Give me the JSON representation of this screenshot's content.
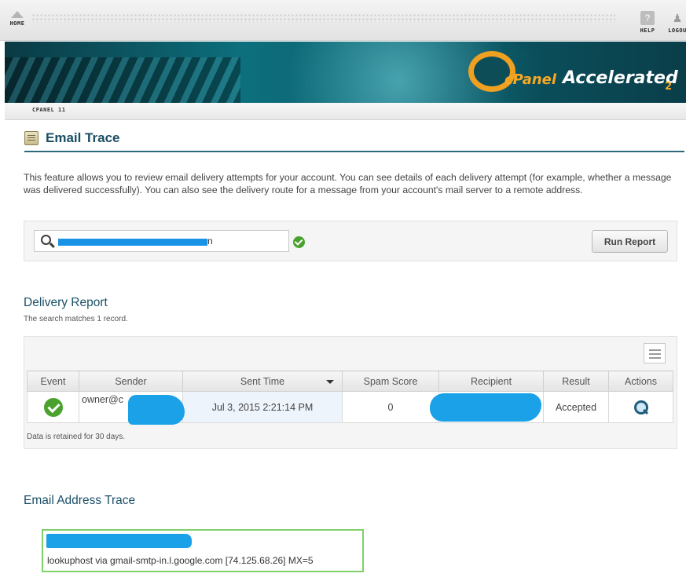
{
  "nav": {
    "home_label": "HOME",
    "help_label": "HELP",
    "logout_label": "LOGOU",
    "help_icon_glyph": "?"
  },
  "banner": {
    "logo_c": "cPanel",
    "logo_accelerated": "Accelerated",
    "logo_sub": "2"
  },
  "breadcrumb": {
    "label": "CPANEL 11"
  },
  "page": {
    "title": "Email Trace",
    "intro": "This feature allows you to review email delivery attempts for your account. You can see details of each delivery attempt (for example, whether a message was delivered successfully). You can also see the delivery route for a message from your account's mail server to a remote address."
  },
  "search": {
    "value": "n",
    "placeholder": "",
    "run_button": "Run Report"
  },
  "delivery_report": {
    "title": "Delivery Report",
    "match_note": "The search matches 1 record.",
    "columns": [
      "Event",
      "Sender",
      "Sent Time",
      "Spam Score",
      "Recipient",
      "Result",
      "Actions"
    ],
    "row": {
      "sender": "owner@c",
      "sent_time": "Jul 3, 2015 2:21:14 PM",
      "spam_score": "0",
      "result": "Accepted"
    },
    "retention_note": "Data is retained for 30 days."
  },
  "address_trace": {
    "title": "Email Address Trace",
    "route_line": "lookuphost via gmail-smtp-in.l.google.com [74.125.68.26] MX=5"
  },
  "colors": {
    "accent": "#1a4f63",
    "success": "#4aa12e",
    "redaction": "#1ba1e8",
    "trace_border": "#7fcf6a"
  }
}
